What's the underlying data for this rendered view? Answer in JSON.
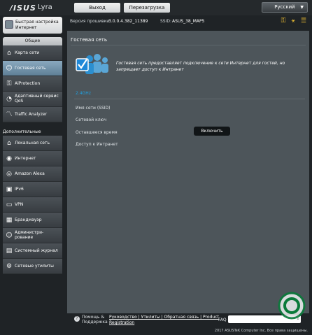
{
  "header": {
    "logo": "/ISUS",
    "product": "Lyra",
    "logout_label": "Выход",
    "reboot_label": "Перезагрузка",
    "language": "Русский"
  },
  "infobar": {
    "firmware_label": "Версия прошивки:",
    "firmware_value": "3.0.0.4.382_11389",
    "ssid_label": "SSID:",
    "ssid_value": "ASUS_38_MAP5"
  },
  "sidebar": {
    "quick_setup": "Быстрая настройка Интернет",
    "general_head": "Общие",
    "general_items": [
      {
        "label": "Карта сети",
        "icon": "network-map-icon"
      },
      {
        "label": "Гостевая сеть",
        "icon": "guest-network-icon"
      },
      {
        "label": "AiProtection",
        "icon": "aiprotection-icon"
      },
      {
        "label": "Адаптивный сервис QoS",
        "icon": "qos-icon"
      },
      {
        "label": "Traffic Analyzer",
        "icon": "traffic-analyzer-icon"
      }
    ],
    "advanced_head": "Дополнительные настройки",
    "advanced_items": [
      {
        "label": "Локальная сеть",
        "icon": "lan-icon"
      },
      {
        "label": "Интернет",
        "icon": "internet-icon"
      },
      {
        "label": "Amazon Alexa",
        "icon": "alexa-icon"
      },
      {
        "label": "IPv6",
        "icon": "ipv6-icon"
      },
      {
        "label": "VPN",
        "icon": "vpn-icon"
      },
      {
        "label": "Брандмауэр",
        "icon": "firewall-icon"
      },
      {
        "label": "Администри- рование",
        "icon": "admin-icon"
      },
      {
        "label": "Системный журнал",
        "icon": "syslog-icon"
      },
      {
        "label": "Сетевые утилиты",
        "icon": "network-tools-icon"
      }
    ]
  },
  "main": {
    "title": "Гостевая сеть",
    "description": "Гостевая сеть предоставляет подключение к сети Интернет для гостей, но запрещает доступ к Интранет",
    "band": "2.4GHz",
    "fields": [
      "Имя сети (SSID)",
      "Сетевой ключ",
      "Оставшееся время",
      "Доступ к Интранет"
    ],
    "enable_label": "Включить"
  },
  "footer": {
    "help": "Помощь & Поддержка",
    "links": "Руководство | Утилиты | Обратная связь | Product Registration",
    "faq": "FAQ",
    "copyright": "2017 ASUSTeK Computer Inc. Все права защищены."
  },
  "colors": {
    "accent": "#1fa0e0",
    "active_menu": "#7a9ab1",
    "panel": "#4d555a"
  }
}
